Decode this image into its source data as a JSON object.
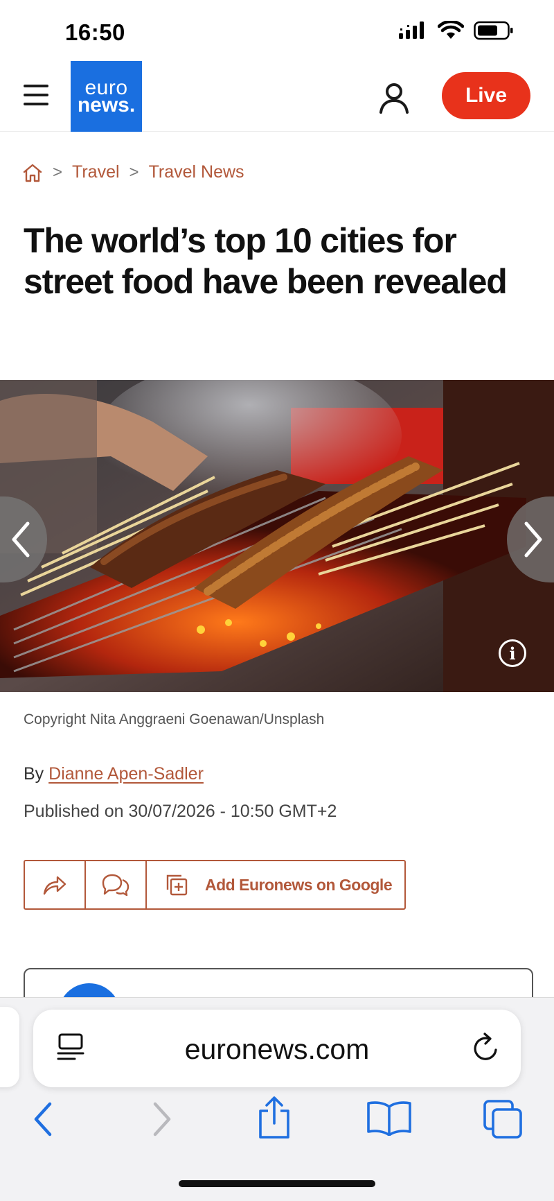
{
  "status_bar": {
    "time": "16:50"
  },
  "header": {
    "logo_line1": "euro",
    "logo_line2": "news.",
    "live_label": "Live",
    "brand_color": "#1a6fe0",
    "live_color": "#e8321b"
  },
  "breadcrumb": {
    "items": [
      "Travel",
      "Travel News"
    ]
  },
  "article": {
    "headline": "The world’s top 10 cities for street food have been revealed",
    "image_credit": "Copyright Nita Anggraeni Goenawan/Unsplash",
    "by_label": "By",
    "author": "Dianne Apen-Sadler",
    "published": "Published on 30/07/2026 - 10:50 GMT+2",
    "accent_color": "#b2583a"
  },
  "actions": {
    "google_label": "Add Euronews on Google"
  },
  "browser": {
    "url": "euronews.com"
  },
  "icons": [
    "menu-icon",
    "user-icon",
    "home-icon",
    "chevron-left-icon",
    "chevron-right-icon",
    "info-icon",
    "share-icon",
    "comment-icon",
    "add-icon",
    "reader-icon",
    "reload-icon",
    "back-icon",
    "forward-icon",
    "share-sheet-icon",
    "bookmarks-icon",
    "tabs-icon"
  ]
}
